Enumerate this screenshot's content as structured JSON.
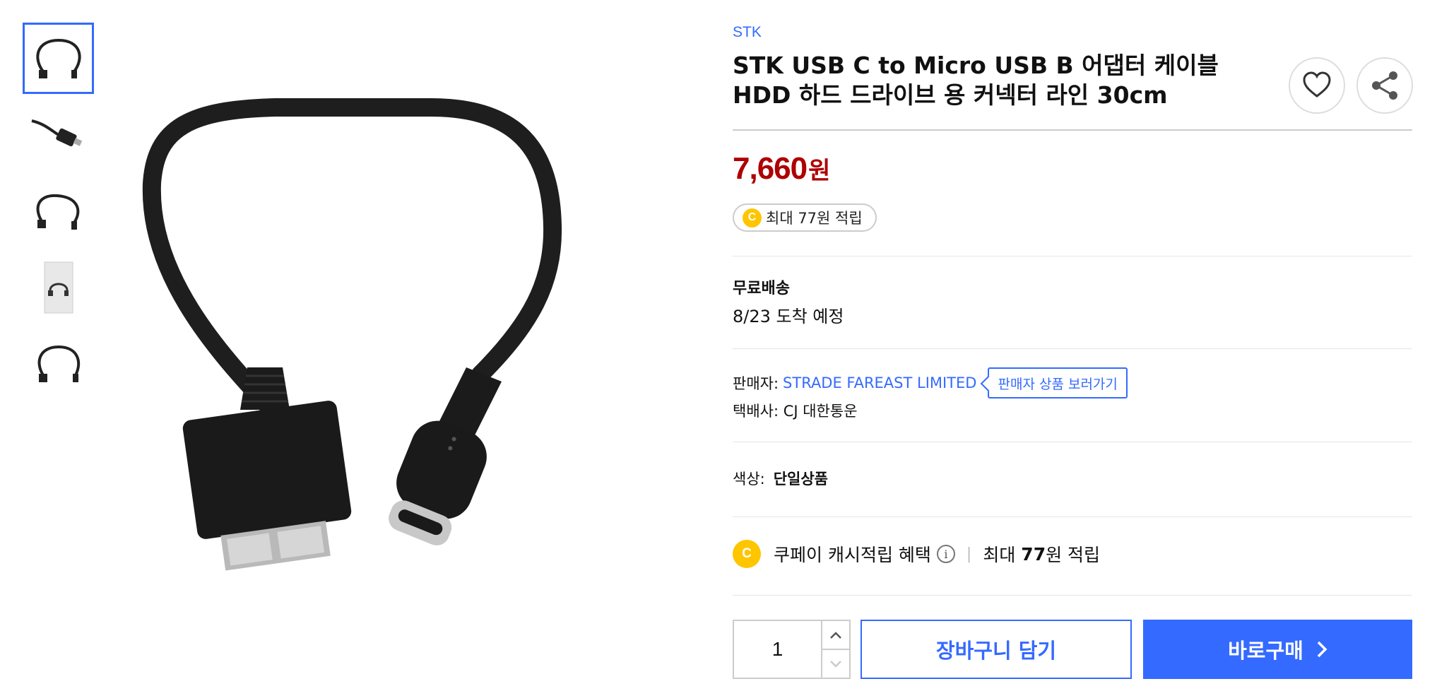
{
  "thumbnails": [
    {
      "label": "cable-loop",
      "active": true
    },
    {
      "label": "micro-b-connector",
      "active": false
    },
    {
      "label": "cable-loop-alt",
      "active": false
    },
    {
      "label": "package",
      "active": false
    },
    {
      "label": "cable-loop-side",
      "active": false
    }
  ],
  "product": {
    "brand": "STK",
    "title": "STK USB C to Micro USB B 어댑터 케이블 HDD 하드 드라이브 용 커넥터 라인 30cm",
    "price": "7,660",
    "currency": "원"
  },
  "cash_badge": {
    "coin": "C",
    "text": "최대 77원 적립"
  },
  "shipping": {
    "title": "무료배송",
    "date": "8/23 도착 예정"
  },
  "seller": {
    "label": "판매자:",
    "name": "STRADE FAREAST LIMITED",
    "link": "판매자 상품 보러가기"
  },
  "courier": {
    "text": "택배사: CJ 대한통운"
  },
  "option": {
    "label": "색상:",
    "value": "단일상품"
  },
  "cashback": {
    "coin": "C",
    "title": "쿠페이 캐시적립 혜택",
    "info": "i",
    "prefix": "최대",
    "amount": "77",
    "suffix": "원 적립"
  },
  "quantity": {
    "value": "1"
  },
  "buttons": {
    "cart": "장바구니 담기",
    "buy": "바로구매"
  },
  "colors": {
    "accent": "#346aff",
    "price": "#ae0000",
    "coin": "#ffc500"
  },
  "icons": [
    "heart-icon",
    "share-icon",
    "chevron-up-icon",
    "chevron-down-icon",
    "chevron-right-icon",
    "info-icon",
    "coin-icon"
  ]
}
